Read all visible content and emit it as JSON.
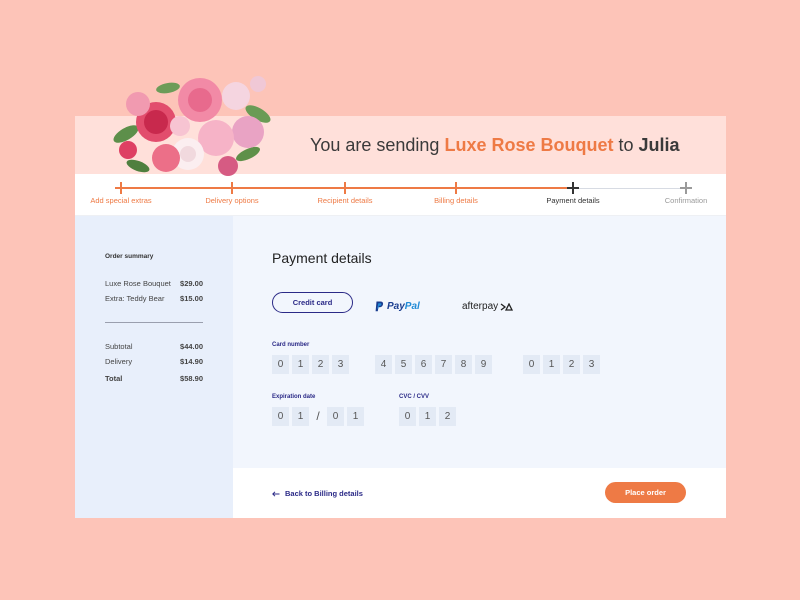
{
  "header": {
    "title_prefix": "You are sending ",
    "product": "Luxe Rose Bouquet",
    "title_mid": " to ",
    "recipient": "Julia"
  },
  "steps": [
    {
      "label": "Add special extras",
      "state": "done"
    },
    {
      "label": "Delivery options",
      "state": "done"
    },
    {
      "label": "Recipient details",
      "state": "done"
    },
    {
      "label": "Billing details",
      "state": "done"
    },
    {
      "label": "Payment details",
      "state": "active"
    },
    {
      "label": "Confirmation",
      "state": "pending"
    }
  ],
  "summary": {
    "title": "Order summary",
    "items": [
      {
        "label": "Luxe Rose Bouquet",
        "value": "$29.00"
      },
      {
        "label": "Extra: Teddy Bear",
        "value": "$15.00"
      }
    ],
    "subtotal": {
      "label": "Subtotal",
      "value": "$44.00"
    },
    "delivery": {
      "label": "Delivery",
      "value": "$14.90"
    },
    "total": {
      "label": "Total",
      "value": "$58.90"
    }
  },
  "payment": {
    "title": "Payment details",
    "methods": {
      "credit": "Credit card",
      "paypal_a": "Pay",
      "paypal_b": "Pal",
      "afterpay": "afterpay"
    },
    "card_number_label": "Card number",
    "card_number_groups": [
      [
        "0",
        "1",
        "2",
        "3"
      ],
      [
        "4",
        "5",
        "6",
        "7",
        "8",
        "9"
      ],
      [
        "0",
        "1",
        "2",
        "3"
      ]
    ],
    "expiration_label": "Expiration date",
    "expiration": {
      "month": [
        "0",
        "1"
      ],
      "separator": "/",
      "year": [
        "0",
        "1"
      ]
    },
    "cvc_label": "CVC / CVV",
    "cvc": [
      "0",
      "1",
      "2"
    ]
  },
  "footer": {
    "back_label": "Back to Billing details",
    "place_order_label": "Place order"
  },
  "colors": {
    "accent": "#ee7a45",
    "primary": "#2b2a87",
    "background": "#fdc4b8",
    "header_bg": "#ffe0da",
    "sidebar_bg": "#e8effb",
    "main_bg": "#f2f6fd"
  }
}
